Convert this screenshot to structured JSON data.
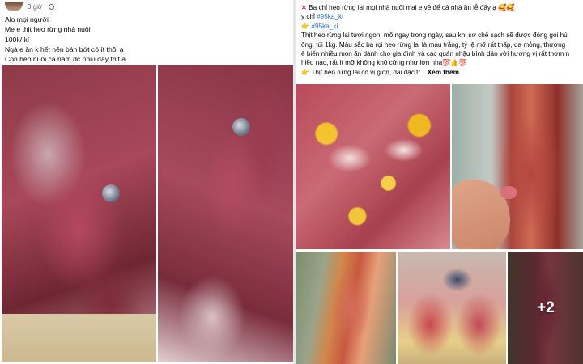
{
  "left_post": {
    "time": "3 giờ ·",
    "caption_lines": [
      "Alo mọi người",
      "Mẹ e thịt heo rừng nhà nuôi",
      "100k/ kí",
      "Ngà e ăn k hết nên bán bớt có ít thôi ạ",
      "Con heo nuôi cả năm đc nhiu đây thịt à"
    ]
  },
  "right_post": {
    "line1_text": "Ba chỉ heo rừng lai mọi nhà nuôi mai e về để cả nhà ăn lễ đây ạ",
    "line1_emojis": "🥰🥰",
    "line2_prefix": "y chỉ",
    "line2_tag": "#95ka_ki",
    "line3_tag": "#95ka_ki",
    "line3_emoji": "👉",
    "body_lines": [
      "Thịt heo rừng lai tươi ngon, mổ ngay trong ngày, sau khi sơ chế sạch sẽ được đóng gói hú",
      "ông, túi 1kg. Màu sắc ba rọi heo rừng lai là màu trắng, tỷ lệ mỡ rất thấp, da mỏng, thường",
      "ế biến nhiều món ăn dành cho gia đình và các quán nhậu bình dân với hương vị rất thơm n",
      "hiều nạc, rất ít mỡ không khô cứng như lợn nhà💯👍💯"
    ],
    "last_line": "Thịt heo rừng lai có vị giòn, dai đặc tr...",
    "see_more": "Xem thêm",
    "more_count": "+2"
  }
}
